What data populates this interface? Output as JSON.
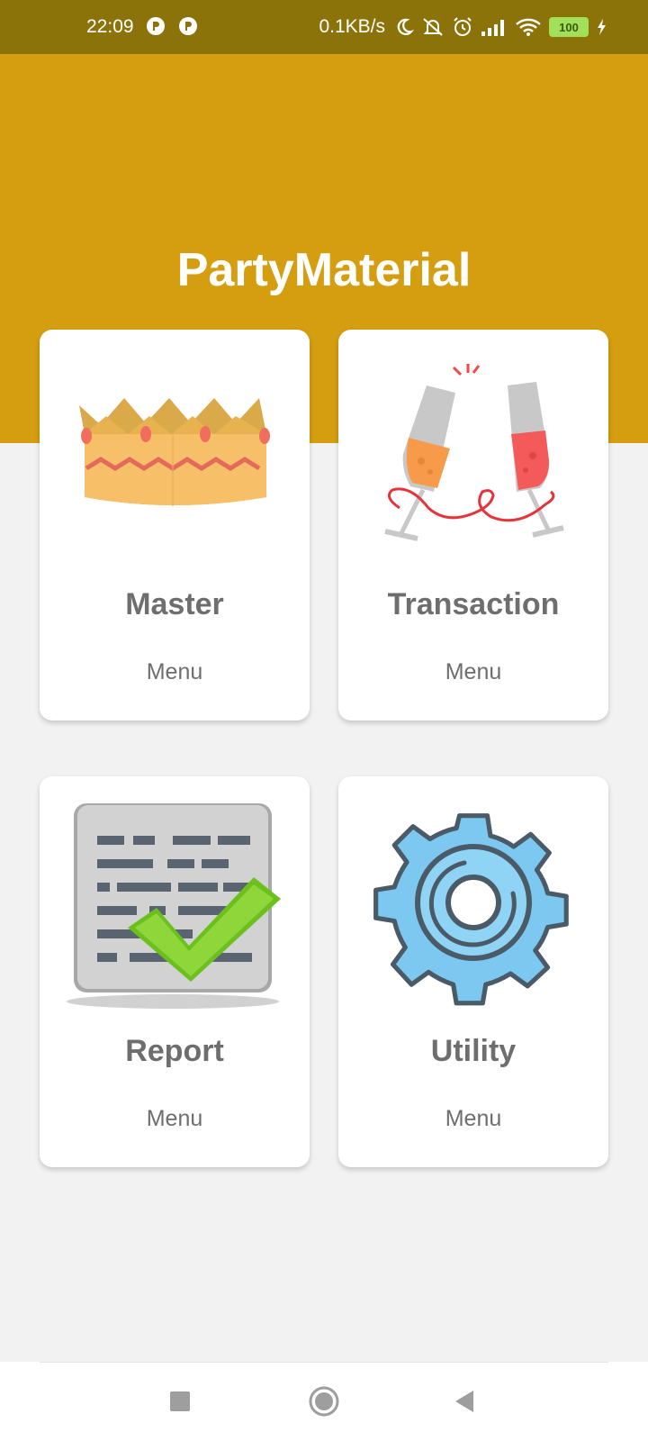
{
  "status_bar": {
    "time": "22:09",
    "net_speed": "0.1KB/s",
    "battery": "100",
    "icons": [
      "app-notification-icon",
      "app-notification-icon",
      "moon-icon",
      "mute-bell-icon",
      "alarm-icon",
      "signal-icon",
      "wifi-icon",
      "battery-icon",
      "charging-icon"
    ]
  },
  "header": {
    "title": "PartyMaterial",
    "color": "#d49e10"
  },
  "cards": [
    {
      "title": "Master",
      "subtitle": "Menu",
      "icon": "crown-icon"
    },
    {
      "title": "Transaction",
      "subtitle": "Menu",
      "icon": "champagne-glasses-icon"
    },
    {
      "title": "Report",
      "subtitle": "Menu",
      "icon": "report-check-icon"
    },
    {
      "title": "Utility",
      "subtitle": "Menu",
      "icon": "gear-icon"
    }
  ],
  "nav_bar": {
    "buttons": [
      "recents-button",
      "home-button",
      "back-button"
    ]
  }
}
